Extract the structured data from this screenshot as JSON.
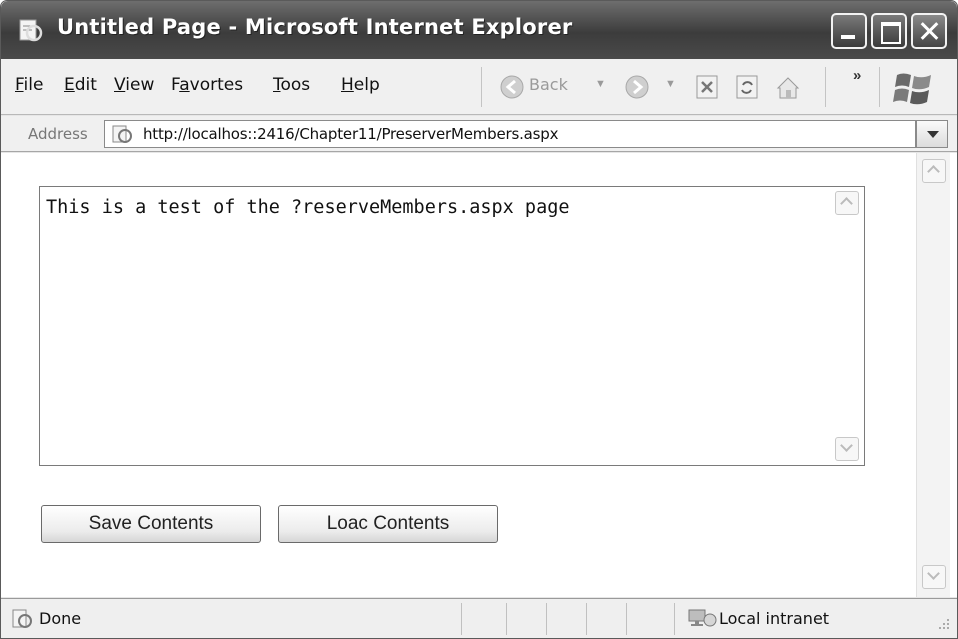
{
  "window": {
    "title": "Untitled Page - Microsoft Internet Explorer"
  },
  "menu": {
    "items": [
      {
        "label": "File",
        "accel": "F"
      },
      {
        "label": "Edit",
        "accel": "E"
      },
      {
        "label": "View",
        "accel": "V"
      },
      {
        "label": "Favortes",
        "accel": "a"
      },
      {
        "label": "Toos",
        "accel": "T"
      },
      {
        "label": "Help",
        "accel": "H"
      }
    ]
  },
  "toolbar": {
    "back_label": "Back",
    "more_label": "»",
    "icons": [
      "back-icon",
      "forward-icon",
      "stop-icon",
      "refresh-icon",
      "home-icon",
      "windows-logo-icon"
    ]
  },
  "address": {
    "label": "Address",
    "url": "http://localhos::2416/Chapter11/PreserverMembers.aspx"
  },
  "page": {
    "textarea_value": "This is a test of the ?reserveMembers.aspx page",
    "save_button": "Save Contents",
    "load_button": "Loac Contents"
  },
  "status": {
    "text": "Done",
    "zone": "Local intranet"
  },
  "colors": {
    "titlebar": "#4a4a4a",
    "chrome": "#f0f0f0",
    "page_background": "#ffffff"
  }
}
